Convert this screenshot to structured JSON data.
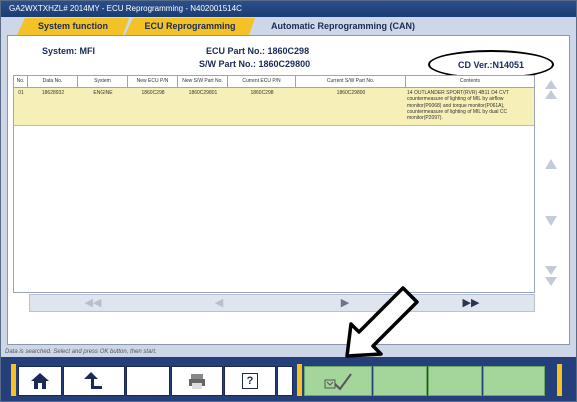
{
  "window": {
    "title": "GA2WXTXHZL# 2014MY  -  ECU Reprogramming  -  N402001514C"
  },
  "tabs": [
    {
      "label": "System function"
    },
    {
      "label": "ECU Reprogramming"
    },
    {
      "label": "Automatic Reprogramming (CAN)"
    }
  ],
  "info": {
    "system_label": "System:",
    "system_value": "MFI",
    "ecu_label": "ECU Part No.:",
    "ecu_value": "1860C298",
    "sw_label": "S/W Part No.:",
    "sw_value": "1860C29800",
    "cd_ver": "CD Ver.:N14051"
  },
  "table": {
    "columns": [
      "No.",
      "Data No.",
      "System",
      "New ECU P/N",
      "New S/W Part No.",
      "Current ECU P/N",
      "Current S/W Part No.",
      "Contents"
    ],
    "rows": [
      {
        "no": "01",
        "data_no": "18628932",
        "system": "ENGINE",
        "new_ecu": "1860C298",
        "new_sw": "1860C29801",
        "cur_ecu": "1860C298",
        "cur_sw": "1860C29800",
        "contents": "14 OUTLANDER SPORT(RVR) 4B11 D4 CVT countermeasure of lighting of MIL by airflow monitor(P0068) and torque monitor(P061A), countermeasure of lighting of MIL by dual CC monitor(P2097)."
      }
    ]
  },
  "nav": {
    "first": "◀◀",
    "prev": "◀",
    "next": "▶",
    "last": "▶▶"
  },
  "status": {
    "text": "Data is searched. Select and press OK button, then start."
  },
  "toolbar": {
    "home_icon": "home-icon",
    "back_icon": "back-icon",
    "print_icon": "print-icon",
    "help_label": "?",
    "ok_icon": "ok-check-icon"
  },
  "colors": {
    "tab_accent": "#f3c226",
    "toolbar_bg": "#253f7b",
    "row_highlight": "#f6f0b8",
    "ok_green": "#a4d69b"
  }
}
